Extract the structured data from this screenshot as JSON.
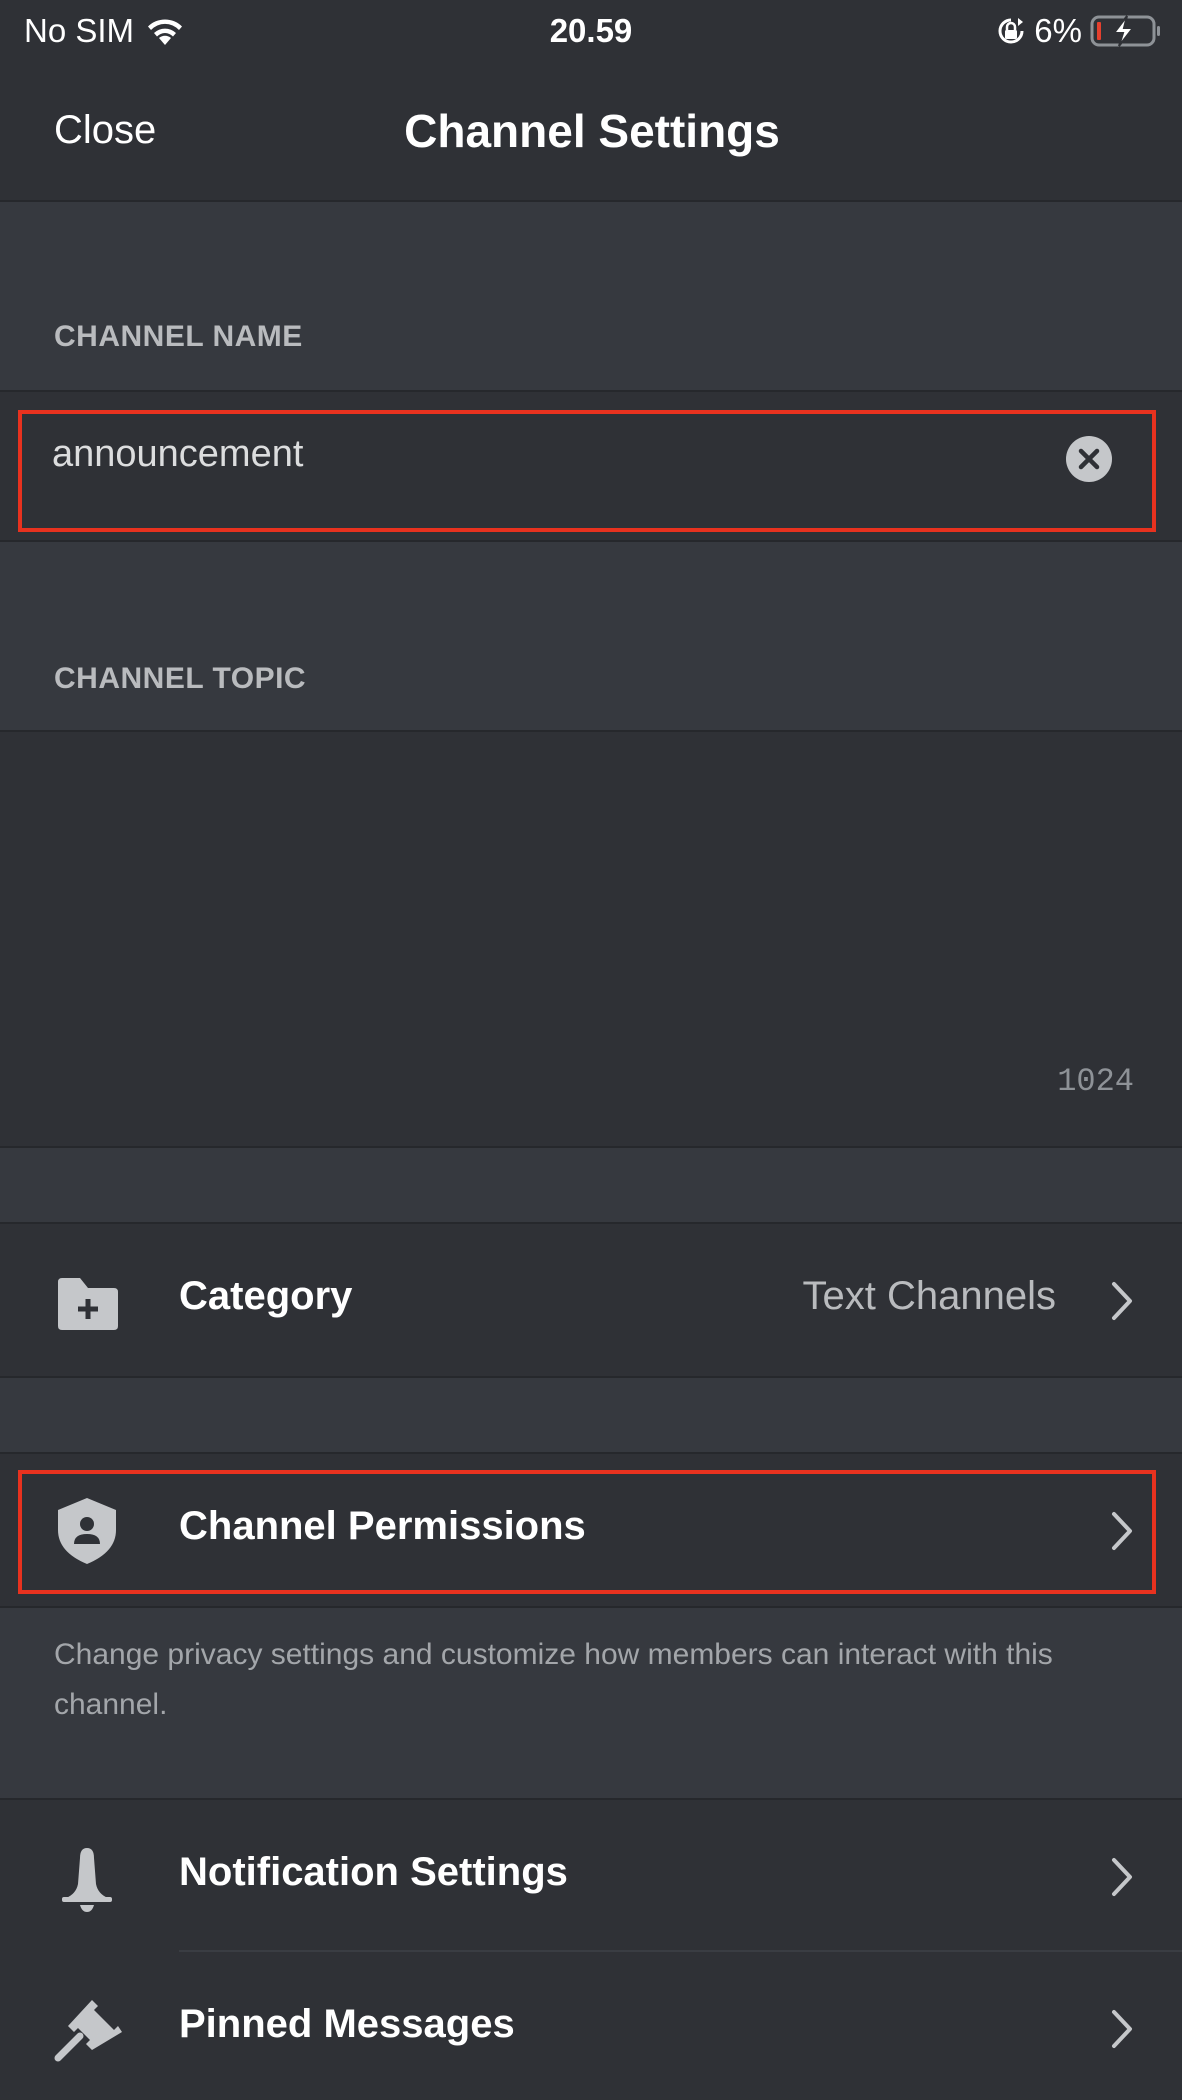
{
  "status_bar": {
    "carrier": "No SIM",
    "time": "20.59",
    "battery_percent": "6%",
    "icons": [
      "wifi-icon",
      "orientation-lock-icon",
      "battery-charging-icon"
    ]
  },
  "nav": {
    "close_label": "Close",
    "title": "Channel Settings"
  },
  "channel_name": {
    "section_label": "CHANNEL NAME",
    "value": "announcement",
    "clear_icon": "clear-circle-icon"
  },
  "channel_topic": {
    "section_label": "CHANNEL TOPIC",
    "value": "",
    "char_remaining": "1024"
  },
  "rows": {
    "category": {
      "icon": "folder-plus-icon",
      "label": "Category",
      "value": "Text Channels"
    },
    "permissions": {
      "icon": "shield-user-icon",
      "label": "Channel Permissions",
      "helper": "Change privacy settings and customize how members can interact with this channel."
    },
    "notifications": {
      "icon": "bell-icon",
      "label": "Notification Settings"
    },
    "pinned": {
      "icon": "pin-icon",
      "label": "Pinned Messages"
    }
  },
  "colors": {
    "background": "#2f3136",
    "section_background": "#36393f",
    "highlight": "#e8321f",
    "battery_low": "#e5402e"
  }
}
